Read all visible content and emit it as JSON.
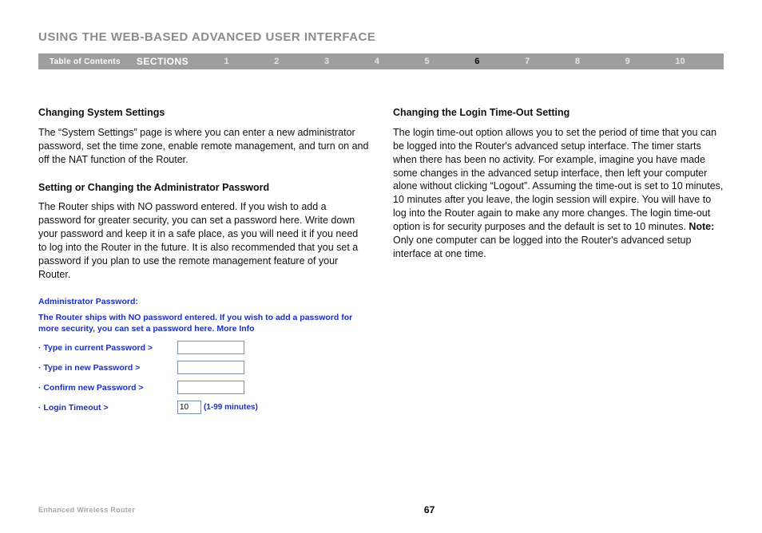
{
  "header": {
    "title": "USING THE WEB-BASED ADVANCED USER INTERFACE"
  },
  "nav": {
    "toc": "Table of Contents",
    "sections": "SECTIONS",
    "nums": [
      "1",
      "2",
      "3",
      "4",
      "5",
      "6",
      "7",
      "8",
      "9",
      "10"
    ],
    "active": "6"
  },
  "left": {
    "h1": "Changing System Settings",
    "p1": "The “System Settings” page is where you can enter a new administrator password, set the time zone, enable remote management, and turn on and off the NAT function of the Router.",
    "h2": "Setting or Changing the Administrator Password",
    "p2": "The Router ships with NO password entered. If you wish to add a password for greater security, you can set a password here. Write down your password and keep it in a safe place, as you will need it if you need to log into the Router in the future. It is also recommended that you set a password if you plan to use the remote management feature of your Router."
  },
  "admin": {
    "title": "Administrator Password:",
    "desc": "The Router ships with NO password entered. If you wish to add a password for more security, you can set a password here.",
    "moreInfo": "More Info",
    "labels": {
      "current": "· Type in current Password >",
      "new": "· Type in new Password >",
      "confirm": "· Confirm new Password >",
      "timeout": "· Login Timeout >"
    },
    "timeoutValue": "10",
    "timeoutHint": "(1-99 minutes)"
  },
  "right": {
    "h1": "Changing the Login Time-Out Setting",
    "p1a": "The login time-out option allows you to set the period of time that you can be logged into the Router's advanced setup interface. The timer starts when there has been no activity. For example, imagine you have made some changes in the advanced setup interface, then left your computer alone without clicking “Logout”. Assuming the time-out is set to 10 minutes, 10 minutes after you leave, the login session will expire. You will have to log into the Router again to make any more changes. The login time-out option is for security purposes and the default is set to 10 minutes. ",
    "noteLabel": "Note:",
    "p1b": " Only one computer can be logged into the Router's advanced setup interface at one time."
  },
  "footer": {
    "brand": "Enhanced Wireless Router",
    "page": "67"
  }
}
